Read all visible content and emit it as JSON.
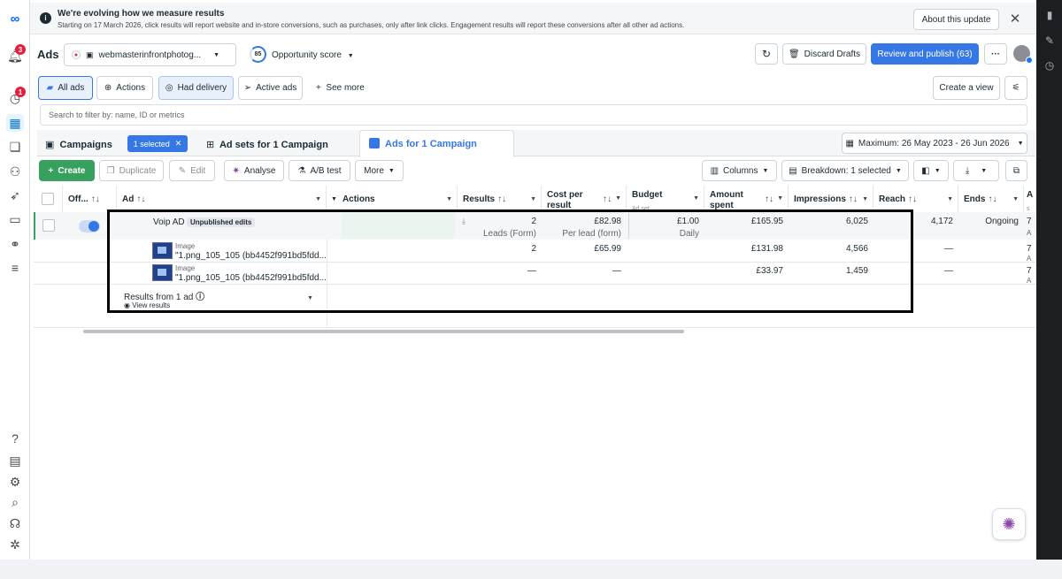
{
  "left_rail": {
    "notif_badge": "3",
    "alert_badge": "1"
  },
  "banner": {
    "title": "We're evolving how we measure results",
    "text": "Starting on 17 March 2026, click results will report website and in-store conversions, such as purchases, only after link clicks. Engagement results will report these conversions after all other ad actions.",
    "about_button": "About this update"
  },
  "header": {
    "title": "Ads",
    "account": "webmasterinfrontphotog...",
    "opportunity_score_value": "85",
    "opportunity_score_label": "Opportunity score",
    "discard_drafts": "Discard Drafts",
    "review_publish": "Review and publish (63)"
  },
  "filters": {
    "all_ads": "All ads",
    "actions": "Actions",
    "had_delivery": "Had delivery",
    "active_ads": "Active ads",
    "see_more": "See more",
    "create_view": "Create a view"
  },
  "search": {
    "placeholder": "Search to filter by: name, ID or metrics"
  },
  "tabs": {
    "campaigns": "Campaigns",
    "selected_chip": "1 selected",
    "ad_sets": "Ad sets for 1 Campaign",
    "ads": "Ads for 1 Campaign",
    "date_range": "Maximum: 26 May 2023 - 26 Jun 2026"
  },
  "toolbar": {
    "create": "Create",
    "duplicate": "Duplicate",
    "edit": "Edit",
    "analyse": "Analyse",
    "ab_test": "A/B test",
    "more": "More",
    "columns": "Columns",
    "breakdown": "Breakdown: 1 selected"
  },
  "table": {
    "headers": {
      "off": "Off...",
      "ad": "Ad",
      "actions": "Actions",
      "results": "Results",
      "cost_per_result": "Cost per result",
      "budget": "Budget",
      "budget_sub": "Ad set",
      "amount_spent": "Amount spent",
      "impressions": "Impressions",
      "reach": "Reach",
      "ends": "Ends",
      "last_letter": "A",
      "last_sub": "s"
    },
    "main_row": {
      "name": "Voip AD",
      "status_chip": "Unpublished edits",
      "results": "2",
      "results_sub": "Leads (Form)",
      "cost": "£82.98",
      "cost_sub": "Per lead (form)",
      "budget": "£1.00",
      "budget_sub": "Daily",
      "spent": "£165.95",
      "impressions": "6,025",
      "reach": "4,172",
      "ends": "Ongoing",
      "last": "7",
      "last_sub": "A"
    },
    "breakdown_rows": [
      {
        "type": "Image",
        "name": "\"1.png_105_105 (bb4452f991bd5fdd...",
        "results": "2",
        "cost": "£65.99",
        "spent": "£131.98",
        "impressions": "4,566",
        "ends": "—",
        "last": "7",
        "last_sub": "A"
      },
      {
        "type": "Image",
        "name": "\"1.png_105_105 (bb4452f991bd5fdd...",
        "results": "—",
        "cost": "—",
        "spent": "£33.97",
        "impressions": "1,459",
        "ends": "—",
        "last": "7",
        "last_sub": "A"
      }
    ],
    "footer": {
      "label": "Results from 1 ad",
      "view_results": "View results"
    }
  },
  "colors": {
    "accent": "#3578e5",
    "create_green": "#36a05c",
    "highlight_border": "#000000"
  }
}
